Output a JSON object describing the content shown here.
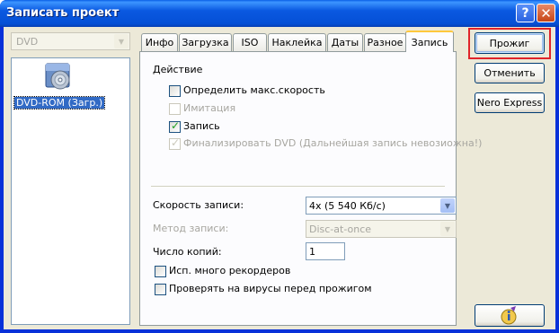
{
  "window": {
    "title": "Записать проект",
    "help_glyph": "?",
    "close_glyph": "✕"
  },
  "left": {
    "drive_combo": {
      "value": "DVD",
      "disabled": true
    },
    "device": {
      "label": "DVD-ROM (Загр.)",
      "icon": "dvd-drive-icon"
    }
  },
  "tabs": [
    {
      "label": "Инфо"
    },
    {
      "label": "Загрузка"
    },
    {
      "label": "ISO"
    },
    {
      "label": "Наклейка"
    },
    {
      "label": "Даты"
    },
    {
      "label": "Разное"
    },
    {
      "label": "Запись",
      "active": true
    }
  ],
  "panel": {
    "action_header": "Действие",
    "options": [
      {
        "label": "Определить макс.скорость",
        "checked": false,
        "enabled": true
      },
      {
        "label": "Имитация",
        "checked": false,
        "enabled": false
      },
      {
        "label": "Запись",
        "checked": true,
        "enabled": true
      },
      {
        "label": "Финализировать DVD (Дальнейшая запись невозиожна!)",
        "checked": true,
        "enabled": false
      }
    ],
    "speed": {
      "label": "Скорость записи:",
      "value": "4x (5 540 Кб/с)"
    },
    "method": {
      "label": "Метод записи:",
      "value": "Disc-at-once",
      "enabled": false
    },
    "copies": {
      "label": "Число копий:",
      "value": "1"
    },
    "multi_recorders": {
      "label": "Исп. много рекордеров",
      "checked": false
    },
    "virus_check": {
      "label": "Проверять на вирусы перед прожигом",
      "checked": false
    }
  },
  "buttons": {
    "burn": "Прожиг",
    "cancel": "Отменить",
    "nero_express": "Nero Express",
    "wizard_icon": "info-wizard-icon"
  },
  "highlight_color": "#e0242a"
}
